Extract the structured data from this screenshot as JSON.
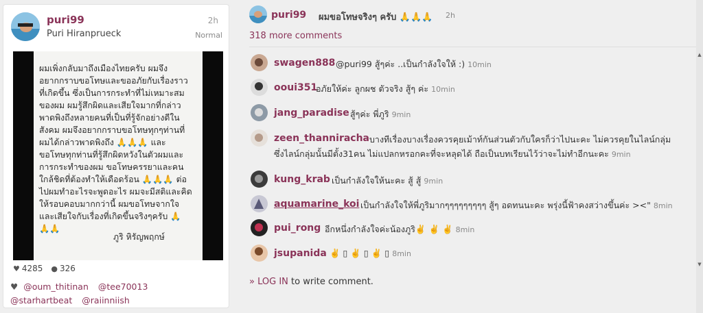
{
  "post": {
    "username": "puri99",
    "full_name": "Puri Hiranprueck",
    "time": "2h",
    "filter": "Normal",
    "letter_lines": [
      "ผมเพิ่งกลับมาถึงเมืองไทยครับ ผมจึง",
      "อยากกราบขอโทษและขออภัยกับเรื่องราว",
      "ที่เกิดขึ้น ซึ่งเป็นการกระทำที่ไม่เหมาะสม",
      "ของผม ผมรู้สึกผิดและเสียใจมากที่กล่าว",
      "พาดพิงถึงหลายคนที่เป็นที่รู้จักอย่างดีใน",
      "สังคม ผมจึงอยากกราบขอโทษทุกๆท่านที่",
      "ผมได้กล่าวพาดพิงถึง 🙏🙏🙏 และ",
      "ขอโทษทุกท่านที่รู้สึกผิดหวังในตัวผมและ",
      "การกระทำของผม ขอโทษครรยาและคน",
      "ใกล้ชิดที่ต้องทำให้เดือดร้อน 🙏🙏🙏 ต่อ",
      "ไปผมทำอะไรจะพูดอะไร ผมจะมีสติและคิด",
      "ให้รอบคอบมากกว่านี้   ผมขอโทษจากใจ",
      "และเสียใจกับเรื่องที่เกิดขึ้นจริงๆครับ 🙏",
      "🙏🙏"
    ],
    "signature": "ภูริ หิรัญพฤกษ์",
    "likes": "4285",
    "comments_count": "326",
    "likers": [
      "@oum_thitinan",
      "@tee70013",
      "@starhartbeat",
      "@raiinniish"
    ]
  },
  "caption": {
    "username": "puri99",
    "text": "ผมขอโทษจริงๆ ครับ 🙏🙏🙏",
    "time": "2h"
  },
  "more_comments": "318 more comments",
  "comments": [
    {
      "user": "swagen888",
      "text": "@puri99 สู้ๆค่ะ ..เป็นกำลังใจให้ :)",
      "time": "10min"
    },
    {
      "user": "ooui351",
      "text": "อภัยให้ค่ะ ลูกผช ตัวจริง สู้ๆ ค่ะ",
      "time": "10min"
    },
    {
      "user": "jang_paradise",
      "text": "สู้ๆค่ะ พี่ภูริ",
      "time": "9min"
    },
    {
      "user": "zeen_thanniracha",
      "text": "บางทีเรื่องบางเรื่องควรคุยเม้าท์กันส่วนตัวกับใครก็ว่าไปนะคะ ไม่ควรคุยในไลน์กลุ่ม",
      "text2": "ซึ่งไลน์กลุ่มนั้นมีตั้ง31คน ไม่แปลกหรอกคะที่จะหลุดได้ ถือเป็นบทเรียนไว้ว่าจะไม่ทำอีกนะคะ",
      "time": "9min"
    },
    {
      "user": "kung_krab",
      "text": "เป็นกำลังใจให้นะคะ สู้ สู้",
      "time": "9min"
    },
    {
      "user": "aquamarine_koi",
      "text": "เป็นกำลังใจให้พี่ภูริมากๆๆๆๆๆๆๆๆๆ สู้ๆ อดทนนะคะ พรุ่งนี้ฟ้าคงสว่างขึ้นค่ะ ><\"",
      "time": "8min"
    },
    {
      "user": "pui_rong",
      "text": "อีกหนึ่งกำลังใจค่ะน้องภูริ✌️ ✌️ ✌️",
      "time": "8min"
    },
    {
      "user": "jsupanida",
      "text": "✌️ ▯ ✌️ ▯ ✌️ ▯",
      "time": "8min"
    }
  ],
  "login": {
    "arrow": "»",
    "link": "LOG IN",
    "rest": "to write comment."
  },
  "colors": {
    "username": "#8a3358",
    "background": "#efefef"
  }
}
